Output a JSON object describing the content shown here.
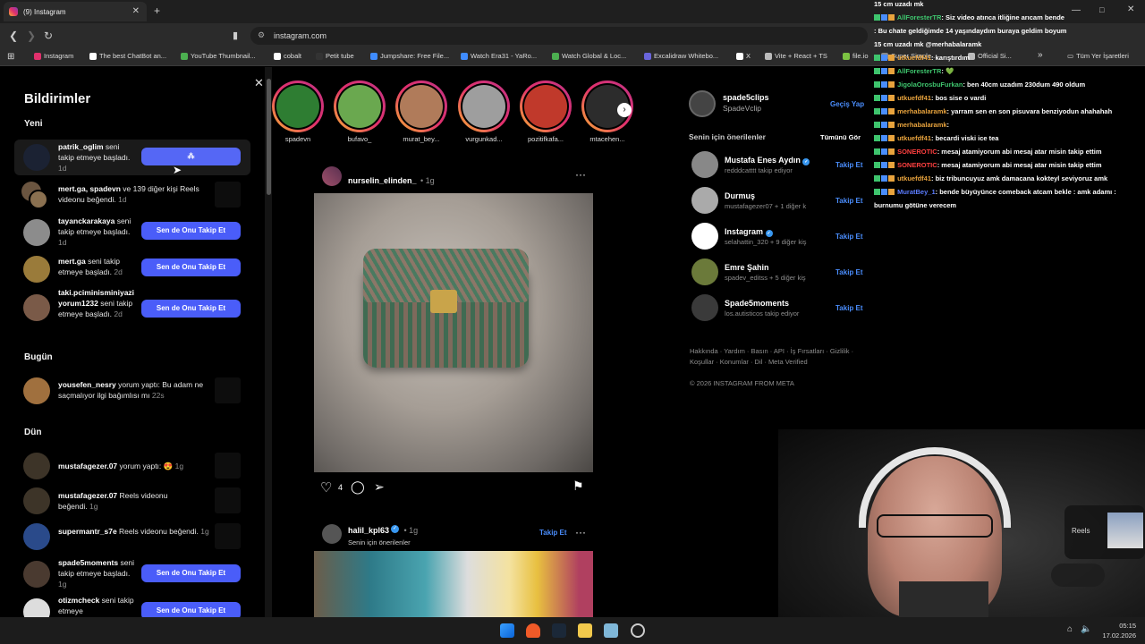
{
  "browser": {
    "tab_title": "(9) Instagram",
    "url": "instagram.com",
    "bookmarks": [
      {
        "label": "Instagram",
        "color": "#e1306c"
      },
      {
        "label": "The best ChatBot an...",
        "color": "#ffffff"
      },
      {
        "label": "YouTube Thumbnail...",
        "color": "#4caf50"
      },
      {
        "label": "cobalt",
        "color": "#ffffff"
      },
      {
        "label": "Petit tube",
        "color": "#333333"
      },
      {
        "label": "Jumpshare: Free File...",
        "color": "#3f8cff"
      },
      {
        "label": "Watch Era31 - YaRo...",
        "color": "#3f8cff"
      },
      {
        "label": "Watch Global & Loc...",
        "color": "#4caf50"
      },
      {
        "label": "Excalidraw Whitebo...",
        "color": "#6965db"
      },
      {
        "label": "X",
        "color": "#ffffff"
      },
      {
        "label": "Vite + React + TS",
        "color": "#bbbbbb"
      },
      {
        "label": "file.io",
        "color": "#7cc242"
      },
      {
        "label": "Super Simple...",
        "color": "#888888"
      },
      {
        "label": "Official Si...",
        "color": "#bbbbbb"
      }
    ],
    "all_bookmarks": "Tüm Yer İşaretleri"
  },
  "notifications": {
    "title": "Bildirimler",
    "sections": {
      "new": "Yeni",
      "today": "Bugün",
      "yesterday": "Dün"
    },
    "follow_btn": "Sen de Onu Takip Et",
    "items": [
      {
        "user": "patrik_oglim",
        "text": " seni takip etmeye başladı.",
        "time": "1d"
      },
      {
        "user": "mert.ga, spadevn",
        "text": " ve 139 diğer kişi Reels videonu beğendi.",
        "time": "1d"
      },
      {
        "user": "tayanckarakaya",
        "text": " seni takip etmeye başladı.",
        "time": "1d"
      },
      {
        "user": "mert.ga",
        "text": " seni takip etmeye başladı.",
        "time": "2d"
      },
      {
        "user": "taki.pciminisminiyaziyorum1232",
        "text": " seni takip etmeye başladı.",
        "time": "2d"
      },
      {
        "user": "yousefen_nesry",
        "text": " yorum yaptı: Bu adam ne saçmalıyor ilgi bağımlısı mı",
        "time": "22s"
      },
      {
        "user": "mustafagezer.07",
        "text": " yorum yaptı: 😍",
        "time": "1g"
      },
      {
        "user": "mustafagezer.07",
        "text": " Reels videonu beğendi.",
        "time": "1g"
      },
      {
        "user": "supermantr_s7e",
        "text": " Reels videonu beğendi.",
        "time": "1g"
      },
      {
        "user": "spade5moments",
        "text": " seni takip etmeye başladı.",
        "time": "1g"
      },
      {
        "user": "otizmcheck",
        "text": " seni takip etmeye",
        "time": ""
      }
    ]
  },
  "stories": [
    {
      "name": "spadevn",
      "color": "#2e7d32"
    },
    {
      "name": "bufavo_",
      "color": "#6aa84f"
    },
    {
      "name": "murat_bey...",
      "color": "#b07b5a"
    },
    {
      "name": "vurgunkad...",
      "color": "#9e9e9e"
    },
    {
      "name": "pozitifkafa...",
      "color": "#c0392b"
    },
    {
      "name": "mtacehen...",
      "color": "#2c2c2c"
    }
  ],
  "posts": [
    {
      "user": "nurselin_elinden_",
      "time": "• 1g",
      "likes": "4"
    },
    {
      "user": "halil_kpl63",
      "time": "• 1g",
      "subtitle": "Senin için önerilenler",
      "follow": "Takip Et"
    }
  ],
  "sidebar": {
    "username": "spade5clips",
    "fullname": "SpadeVclip",
    "switch": "Geçiş Yap",
    "suggestions_title": "Senin için önerilenler",
    "see_all": "Tümünü Gör",
    "follow": "Takip Et",
    "suggestions": [
      {
        "name": "Mustafa Enes Aydın",
        "sub": "redddcatttt takip ediyor",
        "verified": true
      },
      {
        "name": "Durmuş",
        "sub": "mustafagezer07 + 1 diğer k",
        "verified": false
      },
      {
        "name": "Instagram",
        "sub": "selahattin_320 + 9 diğer kiş",
        "verified": true
      },
      {
        "name": "Emre Şahin",
        "sub": "spadev_editss + 5 diğer kiş",
        "verified": false
      },
      {
        "name": "Spade5moments",
        "sub": "los.autisticos takip ediyor",
        "verified": false
      }
    ],
    "footer_links": "Hakkında · Yardım · Basın · API · İş Fırsatları · Gizlilik · Koşullar · Konumlar · Dil · Meta Verified",
    "copyright": "© 2026 INSTAGRAM FROM META"
  },
  "chat": [
    {
      "user": "",
      "msg": "15 cm uzadı mk",
      "color": "#ffffff"
    },
    {
      "user": "AllForesterTR",
      "msg": ": Siz video atınca itliğine arıcam bende",
      "color": "#3ec46d"
    },
    {
      "user": "",
      "msg": ": Bu chate geldiğimde 14 yaşındaydım buraya geldim boyum",
      "color": "#ff4040"
    },
    {
      "user": "",
      "msg": "15 cm uzadı mk @merhabalaramk",
      "color": "#ffffff"
    },
    {
      "user": "utkuefdf41",
      "msg": ": karıştırdım",
      "color": "#e8a33d"
    },
    {
      "user": "AllForesterTR",
      "msg": ": 💚",
      "color": "#3ec46d"
    },
    {
      "user": "JigolaOrosbuFurkan",
      "msg": ": ben 40cm uzadım 230dum 490 oldum",
      "color": "#3ec46d"
    },
    {
      "user": "utkuefdf41",
      "msg": ": bos sise o vardi",
      "color": "#e8a33d"
    },
    {
      "user": "merhabalaramk",
      "msg": ": yarram sen en son pisuvara benziyodun ahahahah",
      "color": "#e8a33d"
    },
    {
      "user": "merhabalaramk",
      "msg": ":",
      "color": "#e8a33d"
    },
    {
      "user": "utkuefdf41",
      "msg": ": becardi viski ice tea",
      "color": "#e8a33d"
    },
    {
      "user": "SONEROTIC",
      "msg": ": mesaj atamiyorum abi mesaj atar misin takip ettim",
      "color": "#ff4040"
    },
    {
      "user": "SONEROTIC",
      "msg": ": mesaj atamiyorum abi mesaj atar misin takip ettim",
      "color": "#ff4040"
    },
    {
      "user": "utkuefdf41",
      "msg": ": biz tribuncuyuz amk damacana kokteyl seviyoruz amk",
      "color": "#e8a33d"
    },
    {
      "user": "MuratBey_1",
      "msg": ": bende büyüyünce comeback atcam bekle : amk adamı :",
      "color": "#5b7cff"
    },
    {
      "user": "",
      "msg": "burnumu götüne verecem",
      "color": "#ffffff"
    }
  ],
  "taskbar": {
    "time": "05:15",
    "date": "17.02.2026"
  },
  "overlay": {
    "reels": "Reels"
  }
}
